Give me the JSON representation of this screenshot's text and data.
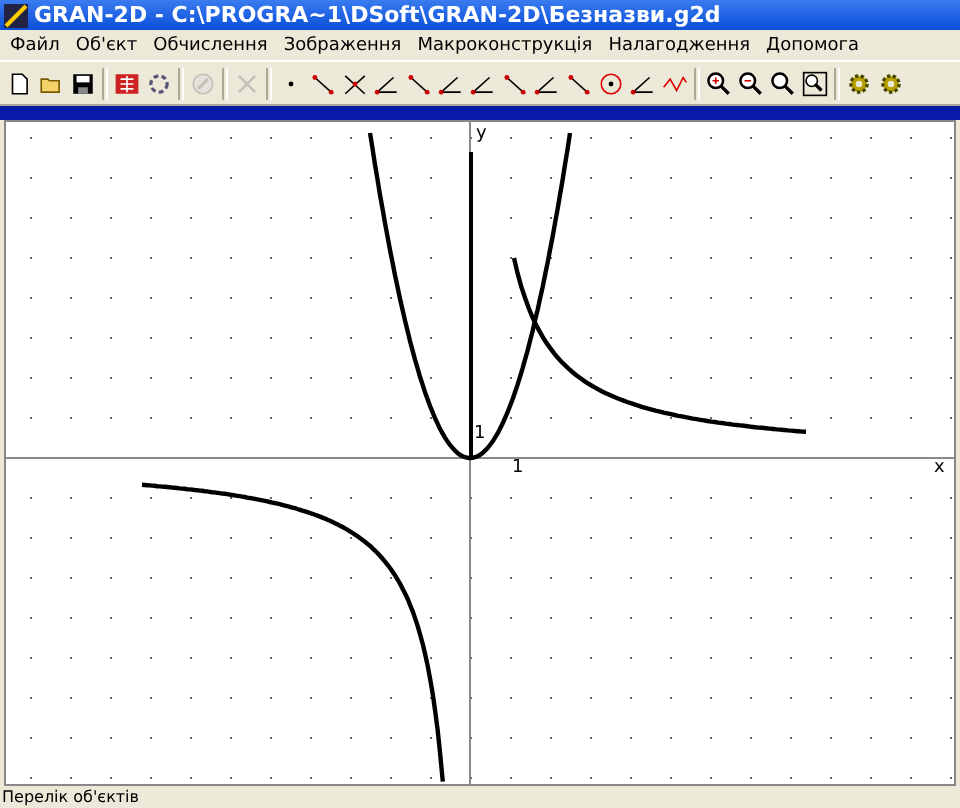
{
  "window": {
    "title": "GRAN-2D - C:\\PROGRA~1\\DSoft\\GRAN-2D\\Безназви.g2d"
  },
  "menu": [
    "Файл",
    "Об'єкт",
    "Обчислення",
    "Зображення",
    "Макроконструкція",
    "Налагодження",
    "Допомога"
  ],
  "toolbar": [
    {
      "kind": "page",
      "disabled": false
    },
    {
      "kind": "folder",
      "disabled": false
    },
    {
      "kind": "disk",
      "disabled": false
    },
    {
      "kind": "sep"
    },
    {
      "kind": "table",
      "disabled": false
    },
    {
      "kind": "arrows",
      "disabled": false
    },
    {
      "kind": "sep"
    },
    {
      "kind": "stop",
      "disabled": true
    },
    {
      "kind": "sep"
    },
    {
      "kind": "scissors",
      "disabled": true
    },
    {
      "kind": "sep"
    },
    {
      "kind": "dot",
      "disabled": false
    },
    {
      "kind": "segment",
      "disabled": false
    },
    {
      "kind": "cross",
      "disabled": false
    },
    {
      "kind": "angle",
      "disabled": false
    },
    {
      "kind": "segment",
      "disabled": false
    },
    {
      "kind": "angle",
      "disabled": false
    },
    {
      "kind": "angle",
      "disabled": false
    },
    {
      "kind": "segment",
      "disabled": false
    },
    {
      "kind": "angle",
      "disabled": false
    },
    {
      "kind": "segment",
      "disabled": false
    },
    {
      "kind": "circle",
      "disabled": false
    },
    {
      "kind": "angle",
      "disabled": false
    },
    {
      "kind": "wave",
      "disabled": false
    },
    {
      "kind": "sep"
    },
    {
      "kind": "zoom-in",
      "disabled": false
    },
    {
      "kind": "zoom-out",
      "disabled": false
    },
    {
      "kind": "zoom",
      "disabled": false
    },
    {
      "kind": "zoom-fit",
      "disabled": false
    },
    {
      "kind": "sep"
    },
    {
      "kind": "gear",
      "disabled": false
    },
    {
      "kind": "gear",
      "disabled": false
    }
  ],
  "plot": {
    "x_axis_label": "x",
    "y_axis_label": "y",
    "x_tick_label": "1",
    "y_tick_label": "1"
  },
  "status_bar": "Перелік об'єктів"
}
